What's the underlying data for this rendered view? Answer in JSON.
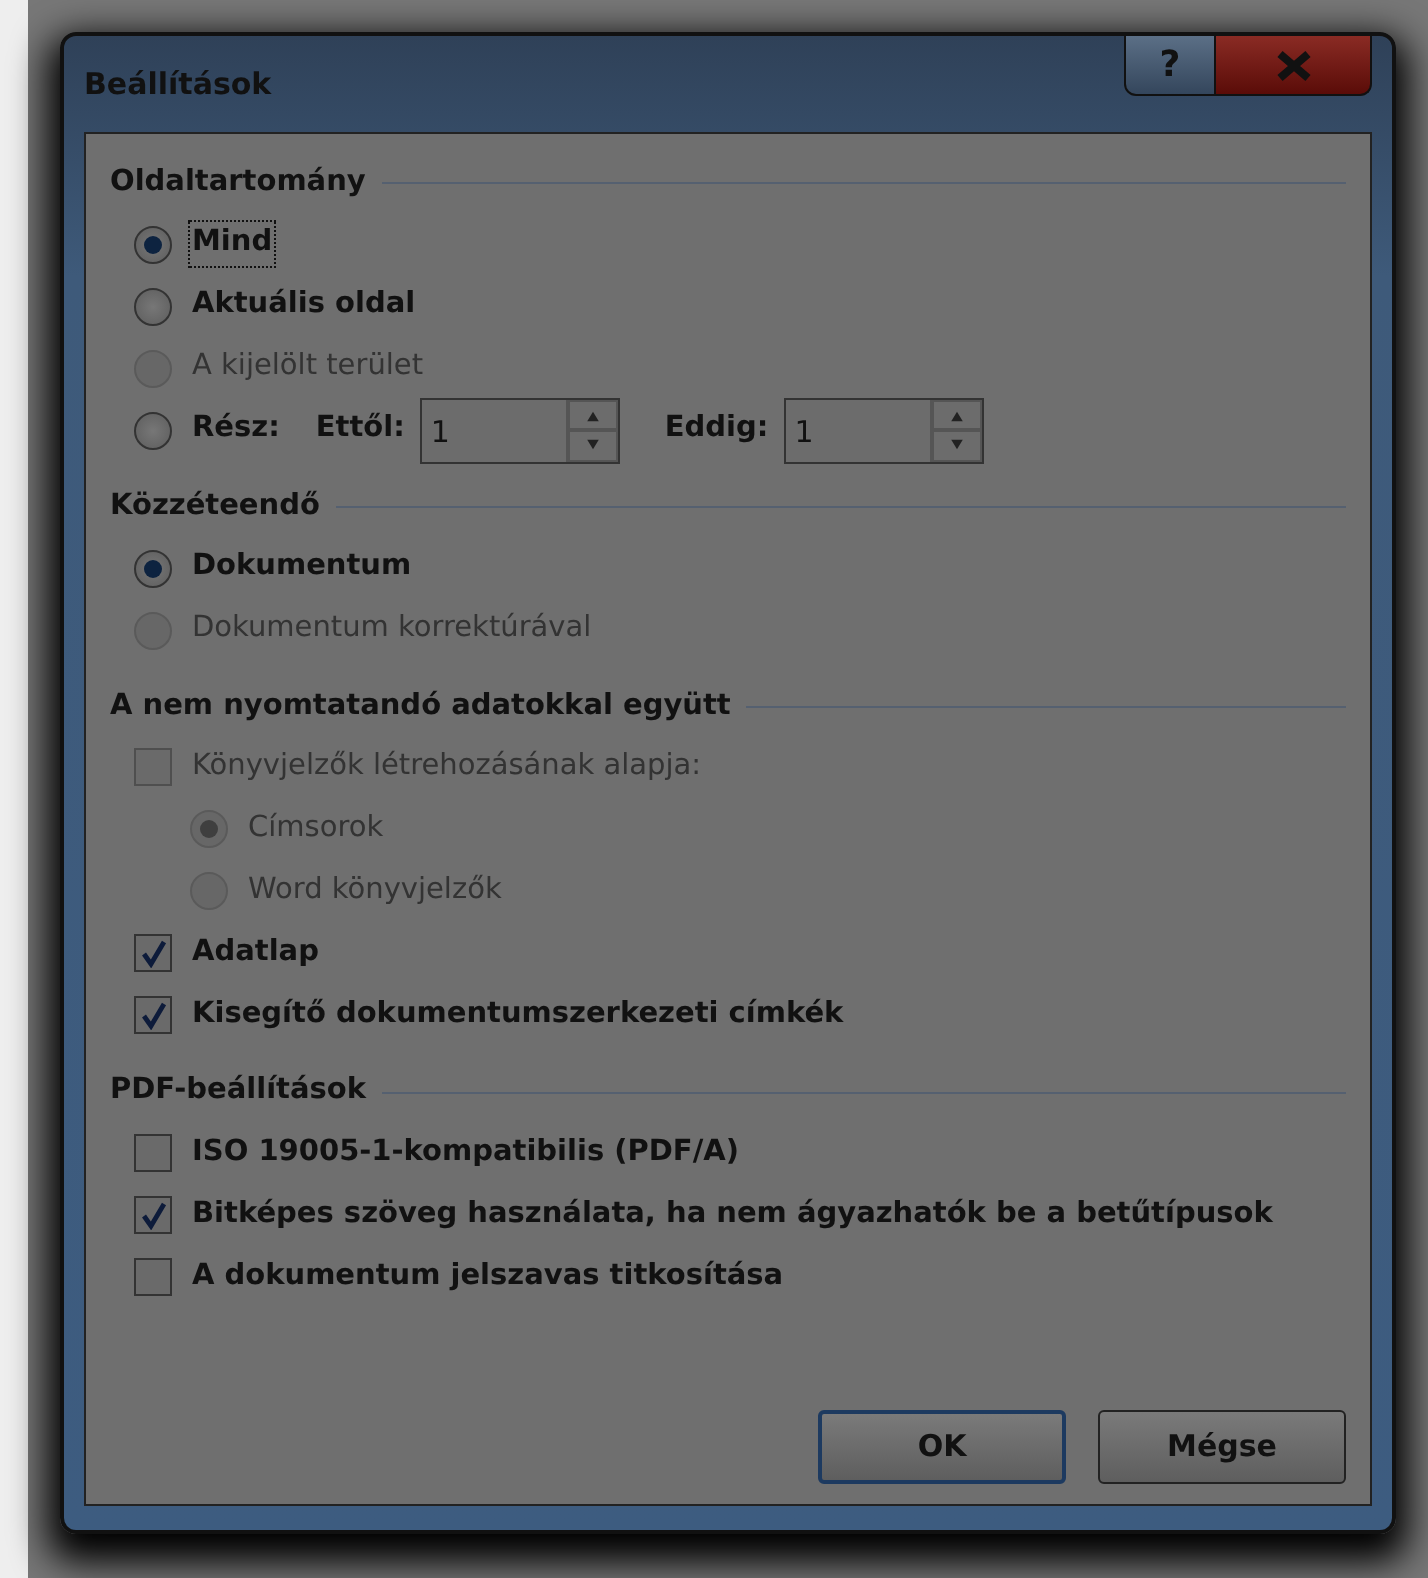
{
  "window": {
    "title": "Beállítások",
    "help": "?"
  },
  "sections": [
    {
      "title": "Oldaltartomány",
      "items": [
        {
          "kind": "radio",
          "label": "Mind",
          "selected": true,
          "disabled": false,
          "focused": true
        },
        {
          "kind": "radio",
          "label": "Aktuális oldal",
          "selected": false,
          "disabled": false,
          "focused": false
        },
        {
          "kind": "radio",
          "label": "A kijelölt terület",
          "selected": false,
          "disabled": true,
          "focused": false
        },
        {
          "kind": "range",
          "label": "Rész:",
          "selected": false,
          "disabled": false,
          "focused": false,
          "from_label": "Ettől:",
          "from_value": "1",
          "to_label": "Eddig:",
          "to_value": "1"
        }
      ]
    },
    {
      "title": "Közzéteendő",
      "items": [
        {
          "kind": "radio",
          "label": "Dokumentum",
          "selected": true,
          "disabled": false
        },
        {
          "kind": "radio",
          "label": "Dokumentum korrektúrával",
          "selected": false,
          "disabled": true
        }
      ]
    },
    {
      "title": "A nem nyomtatandó adatokkal együtt",
      "items": [
        {
          "kind": "checkbox",
          "label": "Könyvjelzők létrehozásának alapja:",
          "checked": false,
          "disabled": true,
          "children": [
            {
              "kind": "radio",
              "label": "Címsorok",
              "selected": true,
              "disabled": true
            },
            {
              "kind": "radio",
              "label": "Word könyvjelzők",
              "selected": false,
              "disabled": true
            }
          ]
        },
        {
          "kind": "checkbox",
          "label": "Adatlap",
          "checked": true,
          "disabled": false
        },
        {
          "kind": "checkbox",
          "label": "Kisegítő dokumentumszerkezeti címkék",
          "checked": true,
          "disabled": false
        }
      ]
    },
    {
      "title": "PDF-beállítások",
      "items": [
        {
          "kind": "checkbox",
          "label": "ISO 19005-1-kompatibilis (PDF/A)",
          "checked": false,
          "disabled": false
        },
        {
          "kind": "checkbox",
          "label": "Bitképes szöveg használata, ha nem ágyazhatók be a betűtípusok",
          "checked": true,
          "disabled": false
        },
        {
          "kind": "checkbox",
          "label": "A dokumentum jelszavas titkosítása",
          "checked": false,
          "disabled": false
        }
      ]
    }
  ],
  "buttons": [
    {
      "label": "OK",
      "default": true
    },
    {
      "label": "Mégse",
      "default": false
    }
  ]
}
